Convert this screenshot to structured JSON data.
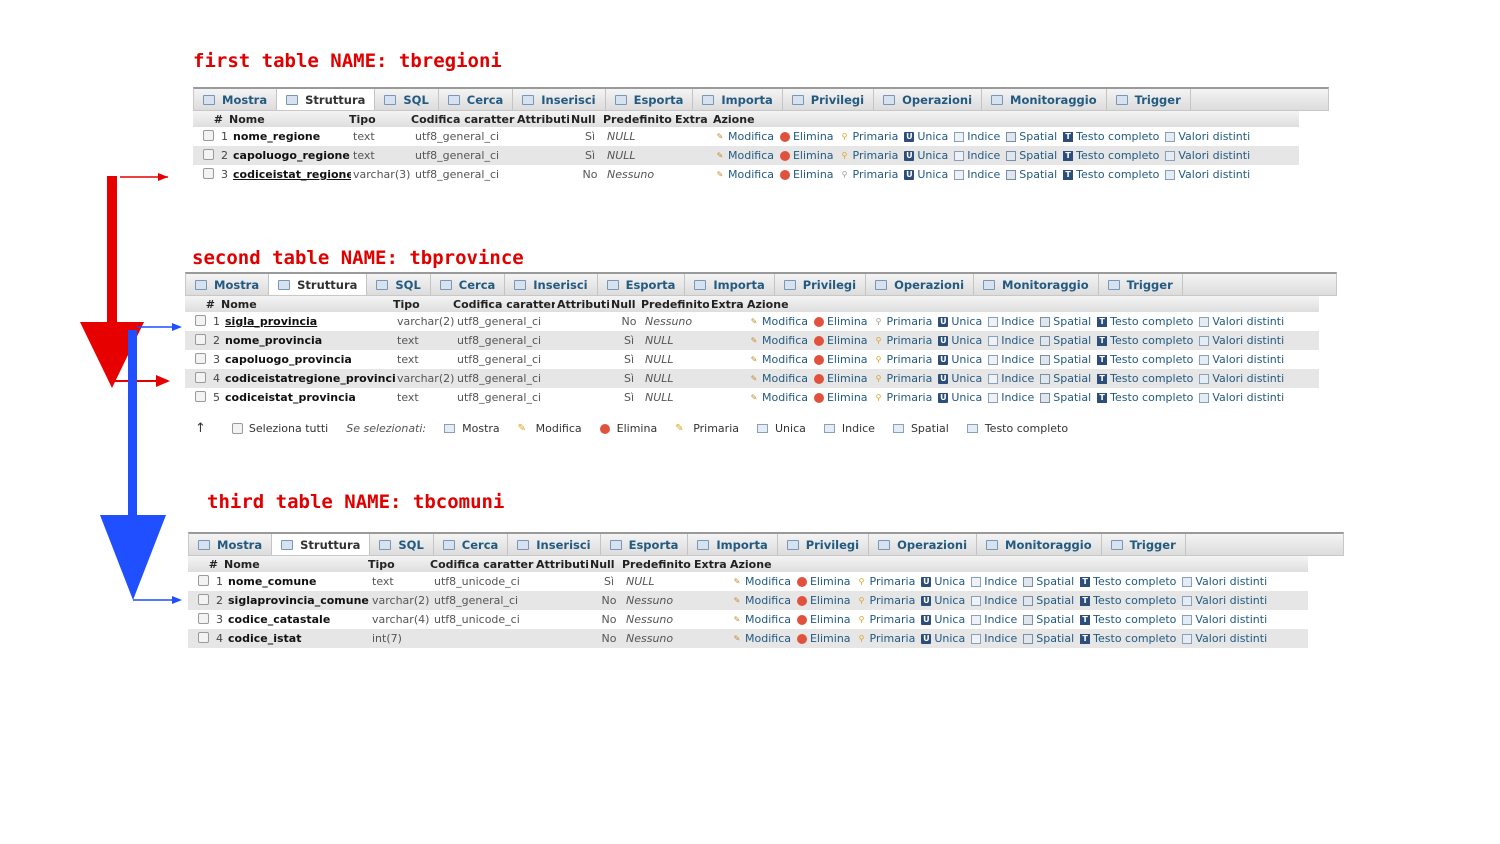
{
  "tabs": [
    {
      "label": "Mostra",
      "icon": "table-icon"
    },
    {
      "label": "Struttura",
      "icon": "structure-icon",
      "active": true
    },
    {
      "label": "SQL",
      "icon": "sql-icon"
    },
    {
      "label": "Cerca",
      "icon": "search-icon"
    },
    {
      "label": "Inserisci",
      "icon": "insert-icon"
    },
    {
      "label": "Esporta",
      "icon": "export-icon"
    },
    {
      "label": "Importa",
      "icon": "import-icon"
    },
    {
      "label": "Privilegi",
      "icon": "privileges-icon"
    },
    {
      "label": "Operazioni",
      "icon": "wrench-icon"
    },
    {
      "label": "Monitoraggio",
      "icon": "eye-icon"
    },
    {
      "label": "Trigger",
      "icon": "trigger-icon"
    }
  ],
  "headers": [
    "#",
    "Nome",
    "Tipo",
    "Codifica caratteri",
    "Attributi",
    "Null",
    "Predefinito",
    "Extra",
    "Azione"
  ],
  "actions": [
    "Modifica",
    "Elimina",
    "Primaria",
    "Unica",
    "Indice",
    "Spatial",
    "Testo completo",
    "Valori distinti"
  ],
  "tables": [
    {
      "title": "first table NAME: tbregioni",
      "rows": [
        {
          "num": "1",
          "name": "nome_regione",
          "type": "text",
          "coll": "utf8_general_ci",
          "attr": "",
          "null": "Sì",
          "def": "NULL",
          "extra": "",
          "key": false
        },
        {
          "num": "2",
          "name": "capoluogo_regione",
          "type": "text",
          "coll": "utf8_general_ci",
          "attr": "",
          "null": "Sì",
          "def": "NULL",
          "extra": "",
          "key": false
        },
        {
          "num": "3",
          "name": "codiceistat_regione",
          "type": "varchar(3)",
          "coll": "utf8_general_ci",
          "attr": "",
          "null": "No",
          "def": "Nessuno",
          "extra": "",
          "key": true
        }
      ]
    },
    {
      "title": "second table NAME: tbprovince",
      "rows": [
        {
          "num": "1",
          "name": "sigla_provincia",
          "type": "varchar(2)",
          "coll": "utf8_general_ci",
          "attr": "",
          "null": "No",
          "def": "Nessuno",
          "extra": "",
          "key": true
        },
        {
          "num": "2",
          "name": "nome_provincia",
          "type": "text",
          "coll": "utf8_general_ci",
          "attr": "",
          "null": "Sì",
          "def": "NULL",
          "extra": "",
          "key": false
        },
        {
          "num": "3",
          "name": "capoluogo_provincia",
          "type": "text",
          "coll": "utf8_general_ci",
          "attr": "",
          "null": "Sì",
          "def": "NULL",
          "extra": "",
          "key": false
        },
        {
          "num": "4",
          "name": "codiceistatregione_provincia",
          "type": "varchar(2)",
          "coll": "utf8_general_ci",
          "attr": "",
          "null": "Sì",
          "def": "NULL",
          "extra": "",
          "key": false
        },
        {
          "num": "5",
          "name": "codiceistat_provincia",
          "type": "text",
          "coll": "utf8_general_ci",
          "attr": "",
          "null": "Sì",
          "def": "NULL",
          "extra": "",
          "key": false
        }
      ],
      "footer": {
        "select_all": "Seleziona tutti",
        "if_selected": "Se selezionati:",
        "items": [
          "Mostra",
          "Modifica",
          "Elimina",
          "Primaria",
          "Unica",
          "Indice",
          "Spatial",
          "Testo completo"
        ]
      }
    },
    {
      "title": "third table NAME: tbcomuni",
      "rows": [
        {
          "num": "1",
          "name": "nome_comune",
          "type": "text",
          "coll": "utf8_unicode_ci",
          "attr": "",
          "null": "Sì",
          "def": "NULL",
          "extra": "",
          "key": false
        },
        {
          "num": "2",
          "name": "siglaprovincia_comune",
          "type": "varchar(2)",
          "coll": "utf8_general_ci",
          "attr": "",
          "null": "No",
          "def": "Nessuno",
          "extra": "",
          "key": false
        },
        {
          "num": "3",
          "name": "codice_catastale",
          "type": "varchar(4)",
          "coll": "utf8_unicode_ci",
          "attr": "",
          "null": "No",
          "def": "Nessuno",
          "extra": "",
          "key": false
        },
        {
          "num": "4",
          "name": "codice_istat",
          "type": "int(7)",
          "coll": "",
          "attr": "",
          "null": "No",
          "def": "Nessuno",
          "extra": "",
          "key": false
        }
      ]
    }
  ],
  "colors": {
    "title": "#e00000",
    "arrow_red": "#e60000",
    "arrow_blue": "#1f4fff",
    "link": "#235a81"
  }
}
